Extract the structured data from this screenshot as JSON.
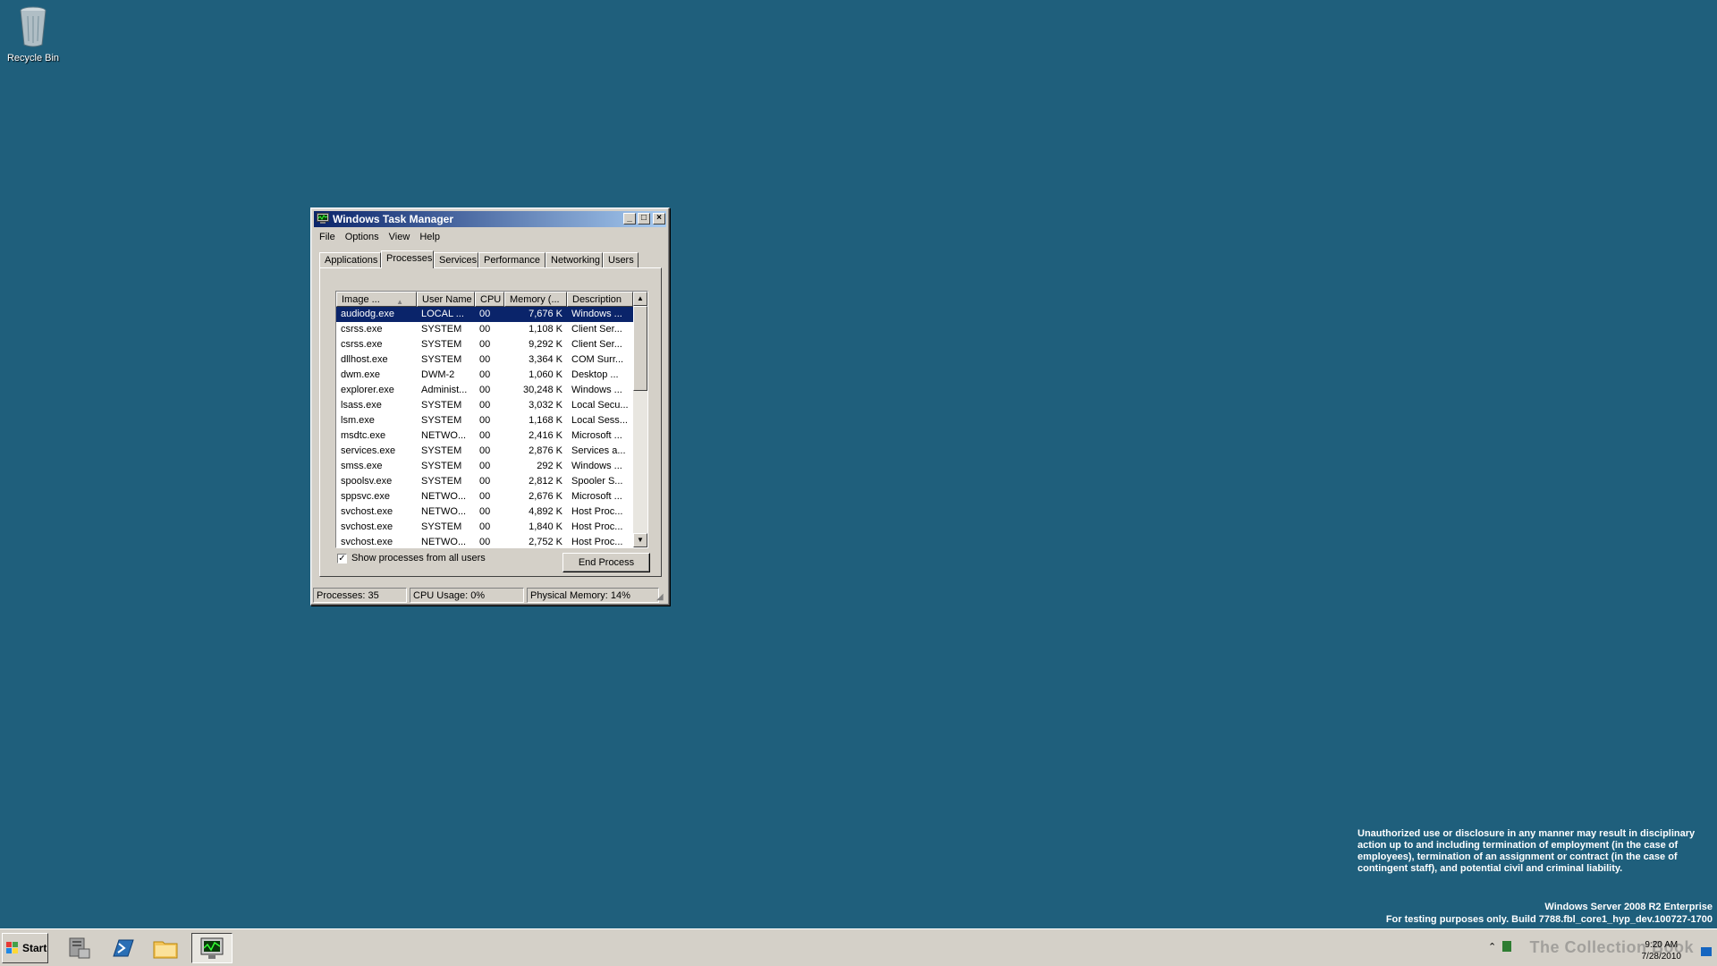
{
  "desktop": {
    "recycle_bin_label": "Recycle Bin"
  },
  "window": {
    "title": "Windows Task Manager",
    "menu": [
      "File",
      "Options",
      "View",
      "Help"
    ],
    "tabs": [
      "Applications",
      "Processes",
      "Services",
      "Performance",
      "Networking",
      "Users"
    ],
    "active_tab": "Processes",
    "columns": [
      "Image ...",
      "User Name",
      "CPU",
      "Memory (...",
      "Description"
    ],
    "rows": [
      [
        "audiodg.exe",
        "LOCAL ...",
        "00",
        "7,676 K",
        "Windows ..."
      ],
      [
        "csrss.exe",
        "SYSTEM",
        "00",
        "1,108 K",
        "Client Ser..."
      ],
      [
        "csrss.exe",
        "SYSTEM",
        "00",
        "9,292 K",
        "Client Ser..."
      ],
      [
        "dllhost.exe",
        "SYSTEM",
        "00",
        "3,364 K",
        "COM Surr..."
      ],
      [
        "dwm.exe",
        "DWM-2",
        "00",
        "1,060 K",
        "Desktop ..."
      ],
      [
        "explorer.exe",
        "Administ...",
        "00",
        "30,248 K",
        "Windows ..."
      ],
      [
        "lsass.exe",
        "SYSTEM",
        "00",
        "3,032 K",
        "Local Secu..."
      ],
      [
        "lsm.exe",
        "SYSTEM",
        "00",
        "1,168 K",
        "Local Sess..."
      ],
      [
        "msdtc.exe",
        "NETWO...",
        "00",
        "2,416 K",
        "Microsoft ..."
      ],
      [
        "services.exe",
        "SYSTEM",
        "00",
        "2,876 K",
        "Services a..."
      ],
      [
        "smss.exe",
        "SYSTEM",
        "00",
        "292 K",
        "Windows ..."
      ],
      [
        "spoolsv.exe",
        "SYSTEM",
        "00",
        "2,812 K",
        "Spooler S..."
      ],
      [
        "sppsvc.exe",
        "NETWO...",
        "00",
        "2,676 K",
        "Microsoft ..."
      ],
      [
        "svchost.exe",
        "NETWO...",
        "00",
        "4,892 K",
        "Host Proc..."
      ],
      [
        "svchost.exe",
        "SYSTEM",
        "00",
        "1,840 K",
        "Host Proc..."
      ],
      [
        "svchost.exe",
        "NETWO...",
        "00",
        "2,752 K",
        "Host Proc..."
      ]
    ],
    "show_all_label": "Show processes from all users",
    "show_all_checked": true,
    "end_process_label": "End Process",
    "status": {
      "processes": "Processes: 35",
      "cpu": "CPU Usage: 0%",
      "memory": "Physical Memory: 14%"
    }
  },
  "legal": {
    "notice": "Unauthorized use or disclosure in any manner may result in disciplinary action up to and including termination of employment (in the case of employees), termination of an assignment or contract (in the case of contingent staff), and potential civil and criminal liability.",
    "edition": "Windows Server 2008 R2 Enterprise",
    "build": "For testing purposes only. Build 7788.fbl_core1_hyp_dev.100727-1700"
  },
  "taskbar": {
    "start_label": "Start",
    "clock_time": "9:20 AM",
    "clock_date": "7/28/2010",
    "watermark": "The Collection Book",
    "pinned": [
      "server-manager",
      "powershell",
      "windows-explorer",
      "task-manager"
    ]
  }
}
